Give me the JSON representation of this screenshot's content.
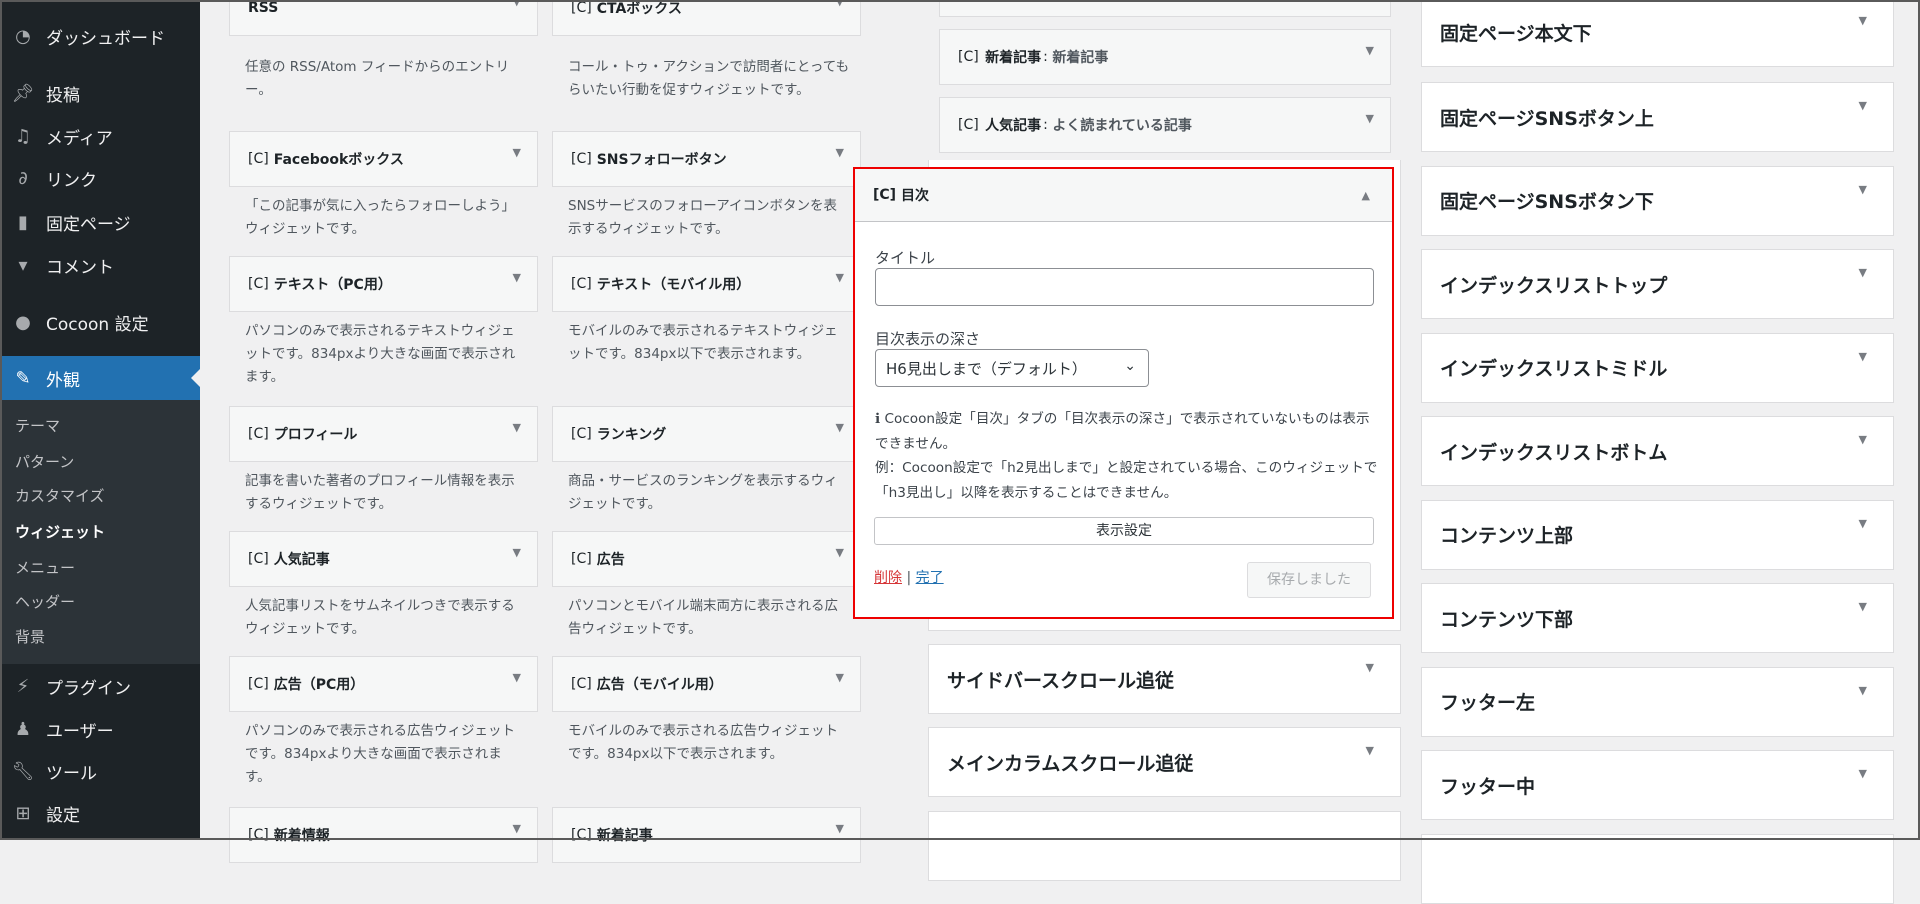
{
  "sidebar": {
    "items": [
      {
        "label": "ダッシュボード",
        "icon": "dashboard-icon"
      },
      {
        "label": "投稿",
        "icon": "pin-icon"
      },
      {
        "label": "メディア",
        "icon": "media-icon"
      },
      {
        "label": "リンク",
        "icon": "link-icon"
      },
      {
        "label": "固定ページ",
        "icon": "page-icon"
      },
      {
        "label": "コメント",
        "icon": "comment-icon"
      },
      {
        "label": "Cocoon 設定",
        "icon": "cocoon-icon"
      },
      {
        "label": "外観",
        "icon": "appearance-icon"
      },
      {
        "label": "プラグイン",
        "icon": "plugin-icon"
      },
      {
        "label": "ユーザー",
        "icon": "user-icon"
      },
      {
        "label": "ツール",
        "icon": "tool-icon"
      },
      {
        "label": "設定",
        "icon": "settings-icon"
      }
    ],
    "submenu": [
      "テーマ",
      "パターン",
      "カスタマイズ",
      "ウィジェット",
      "メニュー",
      "ヘッダー",
      "背景"
    ]
  },
  "available_widgets": [
    {
      "prefix": "",
      "title": "RSS",
      "desc": "任意の RSS/Atom フィードからのエントリー。"
    },
    {
      "prefix": "[C]",
      "title": "CTAボックス",
      "desc": "コール・トゥ・アクションで訪問者にとってもらいたい行動を促すウィジェットです。"
    },
    {
      "prefix": "[C]",
      "title": "Facebookボックス",
      "desc": "「この記事が気に入ったらフォローしよう」ウィジェットです。"
    },
    {
      "prefix": "[C]",
      "title": "SNSフォローボタン",
      "desc": "SNSサービスのフォローアイコンボタンを表示するウィジェットです。"
    },
    {
      "prefix": "[C]",
      "title": "テキスト（PC用）",
      "desc": "パソコンのみで表示されるテキストウィジェットです。834pxより大きな画面で表示されます。"
    },
    {
      "prefix": "[C]",
      "title": "テキスト（モバイル用）",
      "desc": "モバイルのみで表示されるテキストウィジェットです。834px以下で表示されます。"
    },
    {
      "prefix": "[C]",
      "title": "プロフィール",
      "desc": "記事を書いた著者のプロフィール情報を表示するウィジェットです。"
    },
    {
      "prefix": "[C]",
      "title": "ランキング",
      "desc": "商品・サービスのランキングを表示するウィジェットです。"
    },
    {
      "prefix": "[C]",
      "title": "人気記事",
      "desc": "人気記事リストをサムネイルつきで表示するウィジェットです。"
    },
    {
      "prefix": "[C]",
      "title": "広告",
      "desc": "パソコンとモバイル端末両方に表示される広告ウィジェットです。"
    },
    {
      "prefix": "[C]",
      "title": "広告（PC用）",
      "desc": "パソコンのみで表示される広告ウィジェットです。834pxより大きな画面で表示されます。"
    },
    {
      "prefix": "[C]",
      "title": "広告（モバイル用）",
      "desc": "モバイルのみで表示される広告ウィジェットです。834px以下で表示されます。"
    },
    {
      "prefix": "[C]",
      "title": "新着情報",
      "desc": ""
    },
    {
      "prefix": "[C]",
      "title": "新着記事",
      "desc": ""
    }
  ],
  "sidebar_area_widgets": [
    {
      "prefix": "[C]",
      "title": "新着記事",
      "sub": "新着記事"
    },
    {
      "prefix": "[C]",
      "title": "人気記事",
      "sub": "よく読まれている記事"
    }
  ],
  "open_widget": {
    "prefix": "[C]",
    "title": "目次",
    "title_label": "タイトル",
    "title_value": "",
    "depth_label": "目次表示の深さ",
    "depth_value": "H6見出しまで（デフォルト）",
    "note_line1": "Cocoon設定「目次」タブの「目次表示の深さ」で表示されていないものは表示できません。",
    "note_line2": "例：Cocoon設定で「h2見出しまで」と設定されている場合、このウィジェットで「h3見出し」以降を表示することはできません。",
    "display_settings": "表示設定",
    "delete": "削除",
    "separator": "|",
    "done": "完了",
    "save": "保存しました",
    "highlight_color": "#ee0000"
  },
  "middle_areas": [
    "サイドバースクロール追従",
    "メインカラムスクロール追従"
  ],
  "right_areas": [
    "固定ページ本文下",
    "固定ページSNSボタン上",
    "固定ページSNSボタン下",
    "インデックスリストトップ",
    "インデックスリストミドル",
    "インデックスリストボトム",
    "コンテンツ上部",
    "コンテンツ下部",
    "フッター左",
    "フッター中"
  ]
}
